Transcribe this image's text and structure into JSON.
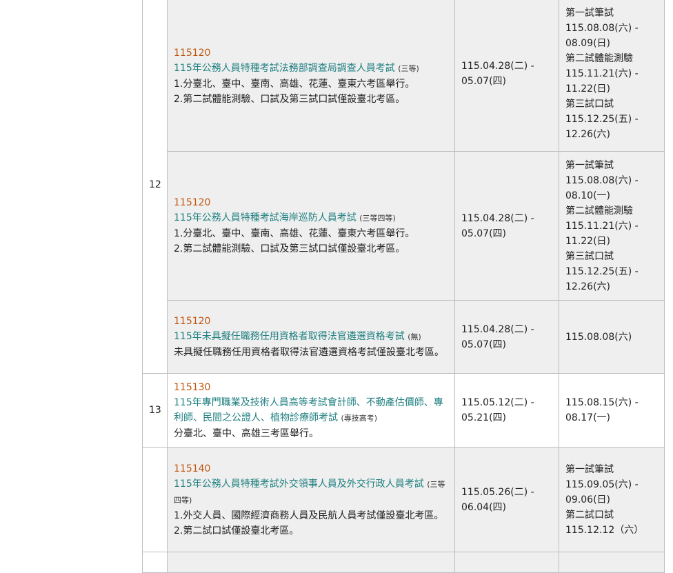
{
  "rows": [
    {
      "number": "12",
      "exams": [
        {
          "code": "115120",
          "title": "115年公務人員特種考試法務部調查局調查人員考試",
          "grade": "(三等)",
          "notes": [
            "1.分臺北、臺中、臺南、高雄、花蓮、臺東六考區舉行。",
            "2.第二試體能測驗、口試及第三試口試僅設臺北考區。"
          ],
          "registration": [
            "115.04.28(二) -",
            "05.07(四)"
          ],
          "exam_dates": [
            "第一試筆試",
            "115.08.08(六) -",
            "08.09(日)",
            "第二試體能測驗",
            "115.11.21(六) -",
            "11.22(日)",
            "第三試口試",
            "115.12.25(五) -",
            "12.26(六)"
          ]
        },
        {
          "code": "115120",
          "title": "115年公務人員特種考試海岸巡防人員考試",
          "grade": "(三等四等)",
          "notes": [
            "1.分臺北、臺中、臺南、高雄、花蓮、臺東六考區舉行。",
            "2.第二試體能測驗、口試及第三試口試僅設臺北考區。"
          ],
          "registration": [
            "115.04.28(二) -",
            "05.07(四)"
          ],
          "exam_dates": [
            "第一試筆試",
            "115.08.08(六) -",
            "08.10(一)",
            "第二試體能測驗",
            "115.11.21(六) -",
            "11.22(日)",
            "第三試口試",
            "115.12.25(五) -",
            "12.26(六)"
          ]
        },
        {
          "code": "115120",
          "title": "115年未具擬任職務任用資格者取得法官遴選資格考試",
          "grade": "(無)",
          "notes": [
            "未具擬任職務任用資格者取得法官遴選資格考試僅設臺北考區。"
          ],
          "registration": [
            "115.04.28(二) -",
            "05.07(四)"
          ],
          "exam_dates": [
            "115.08.08(六)"
          ]
        }
      ]
    },
    {
      "number": "13",
      "exams": [
        {
          "code": "115130",
          "title": "115年專門職業及技術人員高等考試會計師、不動產估價師、專利師、民間之公證人、植物診療師考試",
          "grade": "(專技高考)",
          "notes": [
            "分臺北、臺中、高雄三考區舉行。"
          ],
          "registration": [
            "115.05.12(二) -",
            "05.21(四)"
          ],
          "exam_dates": [
            "115.08.15(六) -",
            "08.17(一)"
          ]
        }
      ]
    },
    {
      "number": "",
      "exams": [
        {
          "code": "115140",
          "title": "115年公務人員特種考試外交領事人員及外交行政人員考試",
          "grade": "(三等四等)",
          "notes": [
            "1.外交人員、國際經濟商務人員及民航人員考試僅設臺北考區。",
            "2.第二試口試僅設臺北考區。"
          ],
          "registration": [
            "115.05.26(二) -",
            "06.04(四)"
          ],
          "exam_dates": [
            "第一試筆試",
            "115.09.05(六) -",
            "09.06(日)",
            "第二試口試",
            "115.12.12（六）"
          ]
        }
      ]
    }
  ]
}
